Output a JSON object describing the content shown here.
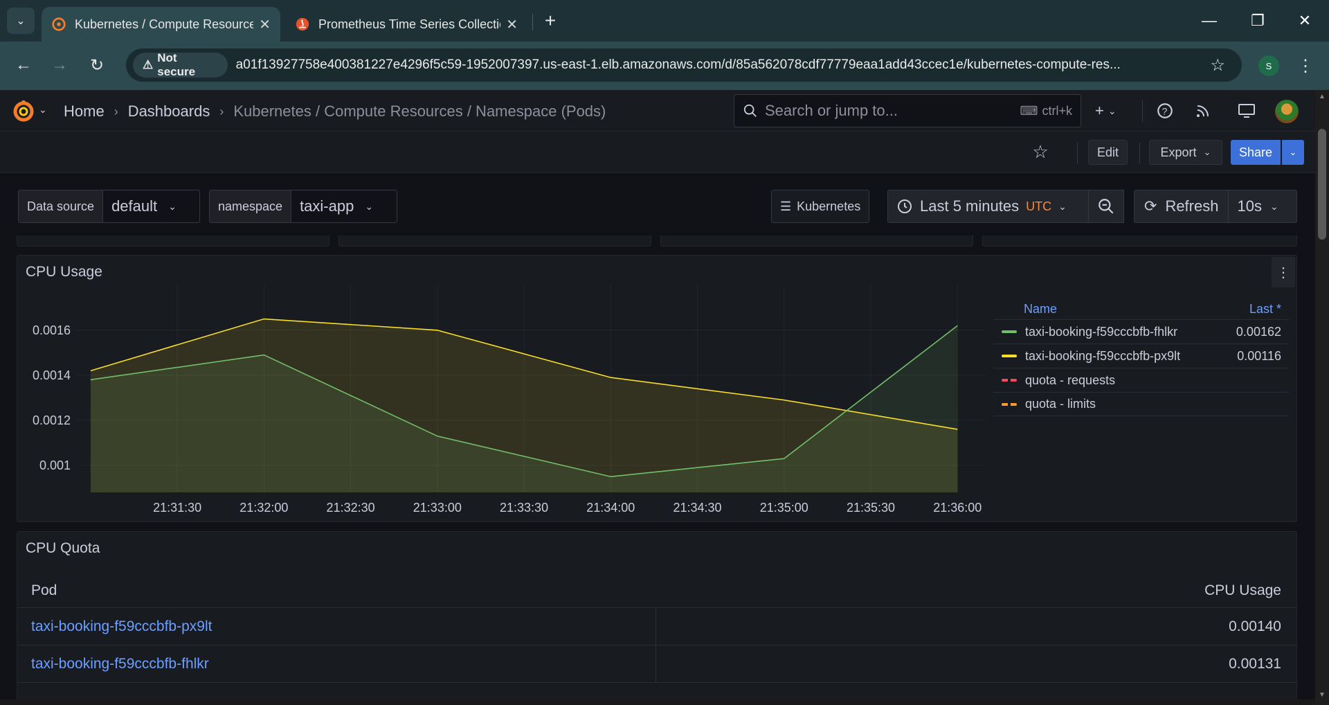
{
  "browser": {
    "tabs": [
      {
        "title": "Kubernetes / Compute Resources / Namespace (Pods)",
        "icon": "grafana-icon",
        "active": true
      },
      {
        "title": "Prometheus Time Series Collection and Processing Server",
        "icon": "prometheus-icon",
        "active": false
      }
    ],
    "security_label": "Not secure",
    "url": "a01f13927758e400381227e4296f5c59-1952007397.us-east-1.elb.amazonaws.com/d/85a562078cdf77779eaa1add43ccec1e/kubernetes-compute-res...",
    "profile_initial": "S"
  },
  "grafana": {
    "breadcrumb": [
      "Home",
      "Dashboards",
      "Kubernetes / Compute Resources / Namespace (Pods)"
    ],
    "search_placeholder": "Search or jump to...",
    "search_shortcut": "ctrl+k",
    "actions": {
      "edit": "Edit",
      "export": "Export",
      "share": "Share"
    },
    "variables": [
      {
        "label": "Data source",
        "value": "default"
      },
      {
        "label": "namespace",
        "value": "taxi-app"
      }
    ],
    "links_button": "Kubernetes",
    "time_range": "Last 5 minutes",
    "timezone": "UTC",
    "refresh_label": "Refresh",
    "refresh_interval": "10s"
  },
  "cpu_usage_panel": {
    "title": "CPU Usage",
    "legend_header": {
      "name": "Name",
      "last": "Last *"
    },
    "legend": [
      {
        "name": "taxi-booking-f59cccbfb-fhlkr",
        "last": "0.00162",
        "color": "#73bf69",
        "dashed": false
      },
      {
        "name": "taxi-booking-f59cccbfb-px9lt",
        "last": "0.00116",
        "color": "#fade2a",
        "dashed": false
      },
      {
        "name": "quota - requests",
        "last": "",
        "color": "#f2495c",
        "dashed": true
      },
      {
        "name": "quota - limits",
        "last": "",
        "color": "#ff9830",
        "dashed": true
      }
    ]
  },
  "chart_data": {
    "type": "area",
    "x": [
      "21:31:00",
      "21:32:00",
      "21:33:00",
      "21:34:00",
      "21:35:00",
      "21:36:00"
    ],
    "x_tick_labels": [
      "21:31:30",
      "21:32:00",
      "21:32:30",
      "21:33:00",
      "21:33:30",
      "21:34:00",
      "21:34:30",
      "21:35:00",
      "21:35:30",
      "21:36:00"
    ],
    "y_tick_labels": [
      "0.001",
      "0.0012",
      "0.0014",
      "0.0016"
    ],
    "ylim": [
      0.00088,
      0.00171
    ],
    "series": [
      {
        "name": "taxi-booking-f59cccbfb-fhlkr",
        "color": "#73bf69",
        "values": [
          0.00138,
          0.00149,
          0.00113,
          0.00095,
          0.00103,
          0.00162
        ]
      },
      {
        "name": "taxi-booking-f59cccbfb-px9lt",
        "color": "#fade2a",
        "values": [
          0.00142,
          0.00165,
          0.0016,
          0.00139,
          0.00129,
          0.00116
        ]
      }
    ],
    "grid": true,
    "legend_position": "right"
  },
  "cpu_quota_panel": {
    "title": "CPU Quota",
    "columns": [
      "Pod",
      "CPU Usage"
    ],
    "rows": [
      {
        "pod": "taxi-booking-f59cccbfb-px9lt",
        "cpu": "0.00140"
      },
      {
        "pod": "taxi-booking-f59cccbfb-fhlkr",
        "cpu": "0.00131"
      }
    ]
  }
}
